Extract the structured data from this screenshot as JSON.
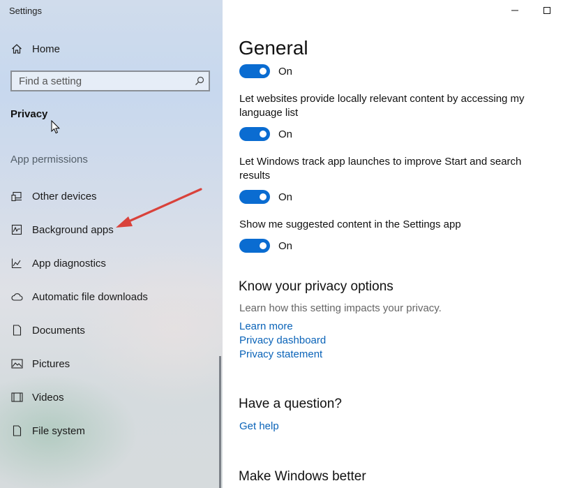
{
  "window": {
    "title": "Settings"
  },
  "sidebar": {
    "home_label": "Home",
    "search": {
      "placeholder": "Find a setting"
    },
    "section_title": "Privacy",
    "group_label": "App permissions",
    "items": [
      {
        "label": "Other devices",
        "icon": "devices-icon"
      },
      {
        "label": "Background apps",
        "icon": "background-apps-icon"
      },
      {
        "label": "App diagnostics",
        "icon": "app-diagnostics-icon"
      },
      {
        "label": "Automatic file downloads",
        "icon": "cloud-icon"
      },
      {
        "label": "Documents",
        "icon": "document-icon"
      },
      {
        "label": "Pictures",
        "icon": "pictures-icon"
      },
      {
        "label": "Videos",
        "icon": "videos-icon"
      },
      {
        "label": "File system",
        "icon": "file-icon"
      }
    ]
  },
  "main": {
    "title": "General",
    "settings": [
      {
        "description": "",
        "state": "On"
      },
      {
        "description": "Let websites provide locally relevant content by accessing my language list",
        "state": "On"
      },
      {
        "description": "Let Windows track app launches to improve Start and search results",
        "state": "On"
      },
      {
        "description": "Show me suggested content in the Settings app",
        "state": "On"
      }
    ],
    "privacy_options": {
      "heading": "Know your privacy options",
      "text": "Learn how this setting impacts your privacy.",
      "links": [
        "Learn more",
        "Privacy dashboard",
        "Privacy statement"
      ]
    },
    "question": {
      "heading": "Have a question?",
      "link": "Get help"
    },
    "better": {
      "heading": "Make Windows better"
    }
  },
  "colors": {
    "accent": "#0a6cd1",
    "link": "#0a63b8",
    "arrow": "#d9423b"
  }
}
